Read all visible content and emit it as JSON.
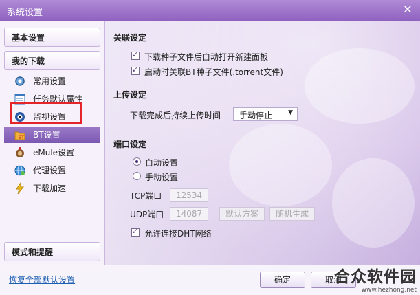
{
  "window": {
    "title": "系统设置"
  },
  "sidebar": {
    "basic": "基本设置",
    "my_downloads": "我的下载",
    "items": [
      {
        "label": "常用设置",
        "icon": "gear-icon"
      },
      {
        "label": "任务默认属性",
        "icon": "list-icon"
      },
      {
        "label": "监视设置",
        "icon": "monitor-eye-icon"
      },
      {
        "label": "BT设置",
        "icon": "bt-folder-icon"
      },
      {
        "label": "eMule设置",
        "icon": "emule-icon"
      },
      {
        "label": "代理设置",
        "icon": "globe-icon"
      },
      {
        "label": "下载加速",
        "icon": "lightning-icon"
      }
    ],
    "mode": "模式和提醒"
  },
  "content": {
    "assoc_title": "关联设定",
    "assoc_opts": [
      {
        "label": "下载种子文件后自动打开新建面板",
        "checked": true
      },
      {
        "label": "启动时关联BT种子文件(.torrent文件)",
        "checked": true
      }
    ],
    "upload_title": "上传设定",
    "upload_label": "下载完成后持续上传时间",
    "upload_value": "手动停止",
    "port_title": "端口设定",
    "port_auto": "自动设置",
    "port_manual": "手动设置",
    "tcp_label": "TCP端口",
    "tcp_value": "12534",
    "udp_label": "UDP端口",
    "udp_value": "14087",
    "default_scheme": "默认方案",
    "random_gen": "随机生成",
    "dht_label": "允许连接DHT网络"
  },
  "footer": {
    "restore": "恢复全部默认设置",
    "ok": "确定",
    "cancel": "取消"
  },
  "watermark": {
    "name": "合众软件园",
    "url": "www.hezhong.net"
  }
}
